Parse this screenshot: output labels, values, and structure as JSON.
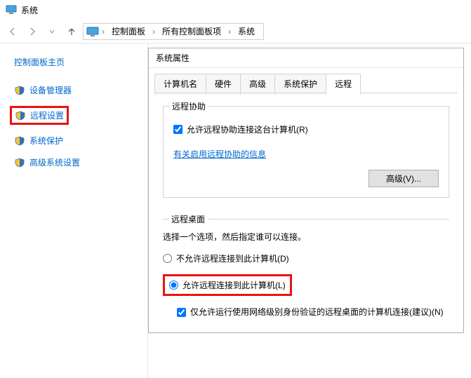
{
  "window": {
    "title": "系统"
  },
  "breadcrumb": {
    "items": [
      "控制面板",
      "所有控制面板项",
      "系统"
    ]
  },
  "sidebar": {
    "home": "控制面板主页",
    "items": [
      {
        "label": "设备管理器"
      },
      {
        "label": "远程设置"
      },
      {
        "label": "系统保护"
      },
      {
        "label": "高级系统设置"
      }
    ]
  },
  "dialog": {
    "title": "系统属性",
    "tabs": [
      {
        "label": "计算机名"
      },
      {
        "label": "硬件"
      },
      {
        "label": "高级"
      },
      {
        "label": "系统保护"
      },
      {
        "label": "远程"
      }
    ],
    "remote_assist": {
      "legend": "远程协助",
      "allow_label": "允许远程协助连接这台计算机(R)",
      "info_link": "有关启用远程协助的信息",
      "advanced_btn": "高级(V)..."
    },
    "remote_desktop": {
      "legend": "远程桌面",
      "desc": "选择一个选项，然后指定谁可以连接。",
      "opt_disallow": "不允许远程连接到此计算机(D)",
      "opt_allow": "允许远程连接到此计算机(L)",
      "nla_label": "仅允许运行使用网络级别身份验证的远程桌面的计算机连接(建议)(N)"
    }
  }
}
